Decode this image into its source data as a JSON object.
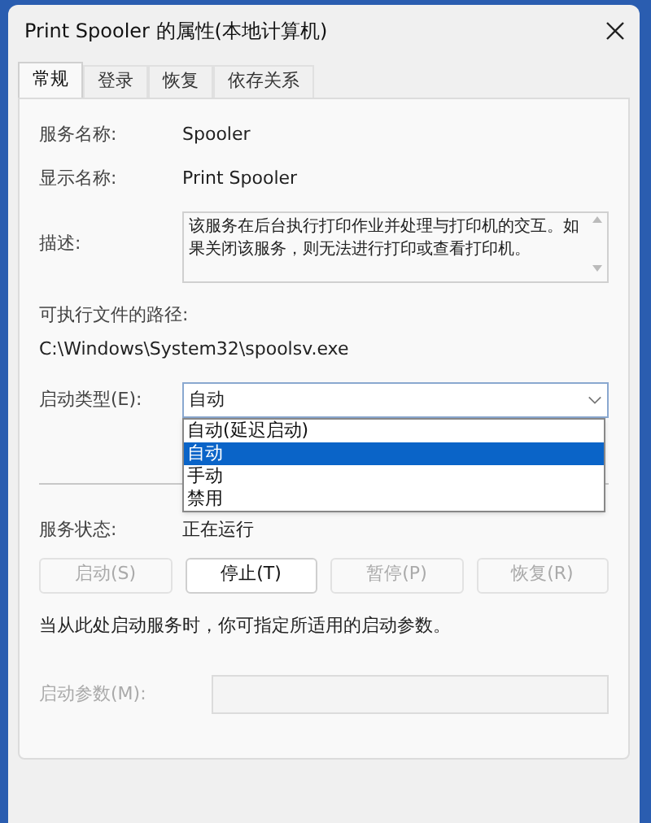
{
  "window": {
    "title": "Print Spooler 的属性(本地计算机)"
  },
  "tabs": [
    {
      "label": "常规",
      "selected": true
    },
    {
      "label": "登录",
      "selected": false
    },
    {
      "label": "恢复",
      "selected": false
    },
    {
      "label": "依存关系",
      "selected": false
    }
  ],
  "fields": [
    {
      "label": "服务名称:",
      "value": "Spooler"
    },
    {
      "label": "显示名称:",
      "value": "Print Spooler"
    }
  ],
  "description": {
    "label": "描述:",
    "value": "该服务在后台执行打印作业并处理与打印机的交互。如果关闭该服务，则无法进行打印或查看打印机。"
  },
  "executable_path": {
    "label": "可执行文件的路径:",
    "value": "C:\\Windows\\System32\\spoolsv.exe"
  },
  "startup_type": {
    "label": "启动类型(E):",
    "value": "自动",
    "expanded": true,
    "options": [
      {
        "label": "自动(延迟启动)",
        "selected": false
      },
      {
        "label": "自动",
        "selected": true
      },
      {
        "label": "手动",
        "selected": false
      },
      {
        "label": "禁用",
        "selected": false
      }
    ]
  },
  "service_status": {
    "label": "服务状态:",
    "value": "正在运行"
  },
  "buttons": [
    {
      "label": "启动(S)",
      "disabled": true
    },
    {
      "label": "停止(T)",
      "disabled": false
    },
    {
      "label": "暂停(P)",
      "disabled": true
    },
    {
      "label": "恢复(R)",
      "disabled": true
    }
  ],
  "note": "当从此处启动服务时，你可指定所适用的启动参数。",
  "start_parameters": {
    "label": "启动参数(M):",
    "disabled": true
  }
}
